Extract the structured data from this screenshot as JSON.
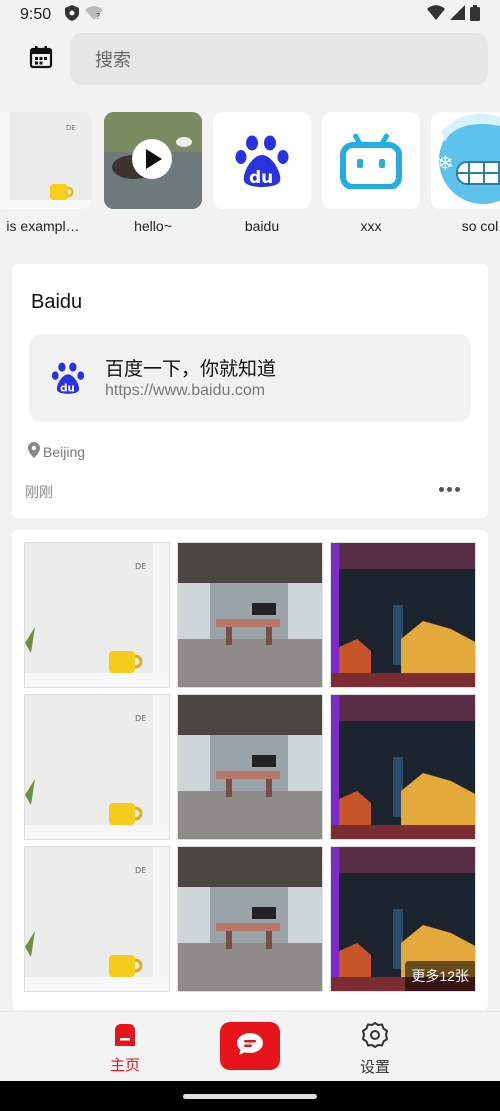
{
  "status_bar": {
    "time": "9:50"
  },
  "search": {
    "placeholder": "搜索"
  },
  "stories": [
    {
      "caption": "is exampl…",
      "icon": "photo-mug"
    },
    {
      "caption": "hello~",
      "icon": "play-video"
    },
    {
      "caption": "baidu",
      "icon": "baidu-paw-logo"
    },
    {
      "caption": "xxx",
      "icon": "bilibili-tv-logo"
    },
    {
      "caption": "so col",
      "icon": "cold-face-emoji"
    }
  ],
  "post": {
    "title": "Baidu",
    "link_title": "百度一下，你就知道",
    "link_url": "https://www.baidu.com",
    "location": "Beijing",
    "time": "刚刚"
  },
  "gallery": {
    "images": [
      "mug-photo",
      "office-photo",
      "night-building-photo",
      "mug-photo",
      "office-photo",
      "night-building-photo",
      "mug-photo",
      "office-photo",
      "night-building-photo"
    ],
    "more_label": "更多12张"
  },
  "bottom_nav": {
    "home_label": "主页",
    "settings_label": "设置"
  },
  "colors": {
    "accent": "#e6151b",
    "baidu_blue": "#2932e1",
    "bilibili_blue": "#23ade5"
  }
}
